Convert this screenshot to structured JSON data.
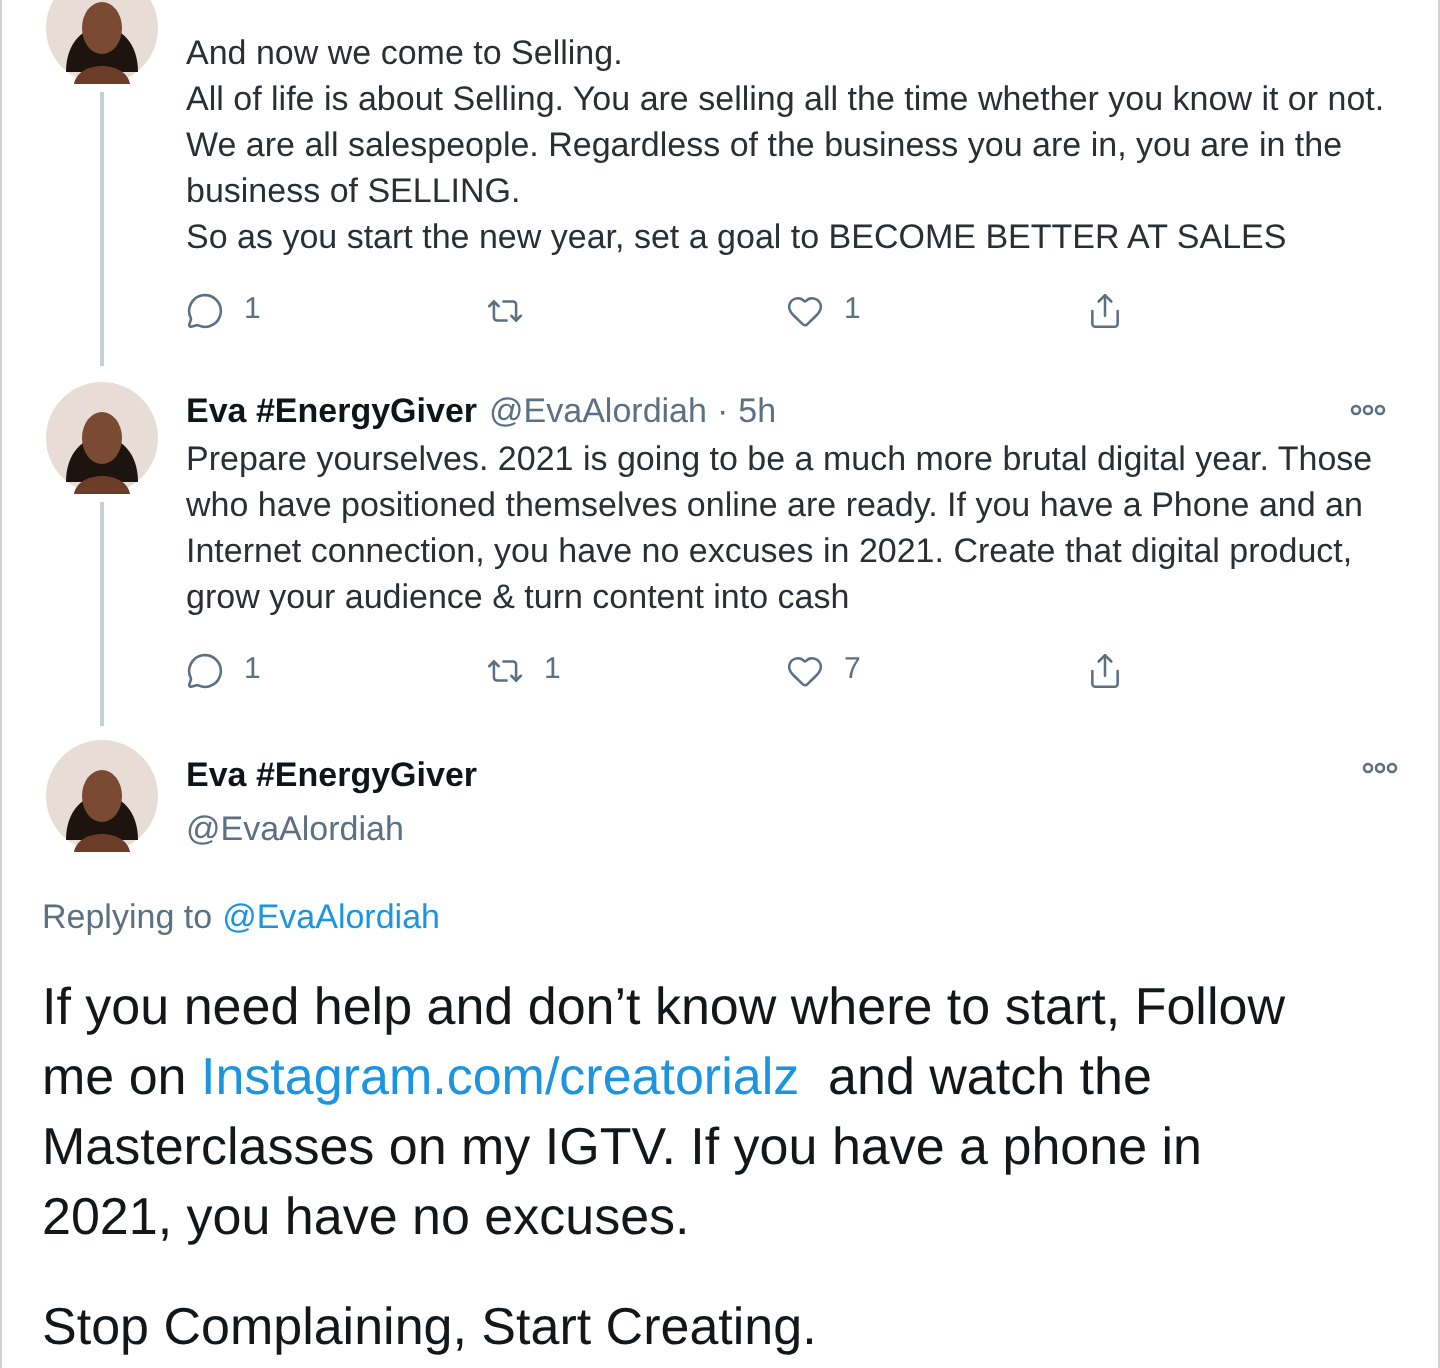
{
  "thread": [
    {
      "paragraphs": [
        "And now we come to Selling.",
        "All of life is about Selling. You are selling all the time whether you know it or not. We are all salespeople. Regardless of the business you are in, you are in the business of SELLING.",
        "So as you start the new year, set a goal to BECOME BETTER AT SALES"
      ],
      "actions": [
        {
          "kind": "reply",
          "count": "1"
        },
        {
          "kind": "retweet"
        },
        {
          "kind": "like",
          "count": "1"
        },
        {
          "kind": "share"
        }
      ]
    },
    {
      "name": "Eva #EnergyGiver",
      "handle": "@EvaAlordiah",
      "separator": "·",
      "time": "5h",
      "paragraphs": [
        "Prepare yourselves. 2021 is going to be a much more brutal digital year. Those who have positioned themselves online are ready. If you have a Phone and an Internet connection, you have no excuses in 2021. Create that digital product, grow your audience & turn content into cash"
      ],
      "actions": [
        {
          "kind": "reply",
          "count": "1"
        },
        {
          "kind": "retweet",
          "count": "1"
        },
        {
          "kind": "like",
          "count": "7"
        },
        {
          "kind": "share"
        }
      ]
    }
  ],
  "main_tweet": {
    "name": "Eva #EnergyGiver",
    "handle": "@EvaAlordiah",
    "replying_label": "Replying to",
    "replying_to": "@EvaAlordiah",
    "paragraphs": [
      [
        {
          "kind": "text",
          "text": "If you need help and don’t know where to start, Follow me on "
        },
        {
          "kind": "link",
          "text": "Instagram.com/creatorialz"
        },
        {
          "kind": "text",
          "text": "  and watch the Masterclasses on my IGTV. If you have a phone in 2021, you have no excuses."
        }
      ],
      [
        {
          "kind": "text",
          "text": "Stop Complaining, Start Creating."
        }
      ]
    ]
  }
}
